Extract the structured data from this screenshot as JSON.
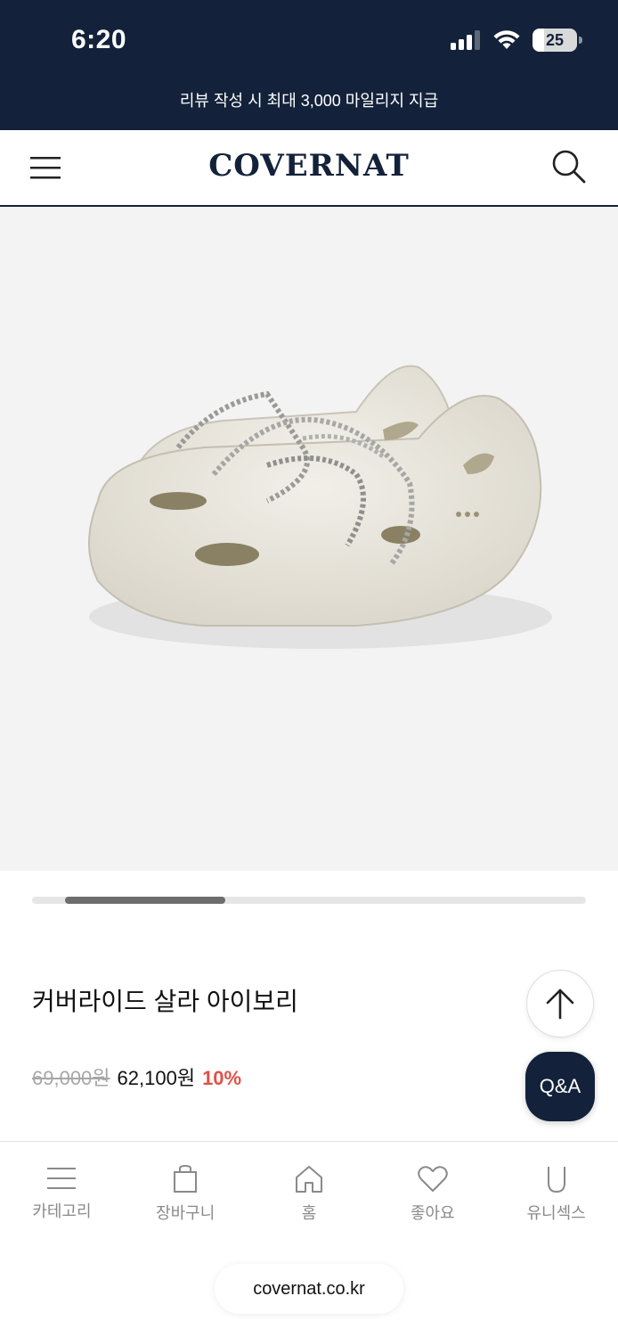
{
  "status_bar": {
    "time": "6:20",
    "battery": "25",
    "battery_level": 0.25
  },
  "promo": {
    "text": "리뷰 작성 시 최대 3,000 마일리지 지급"
  },
  "header": {
    "logo": "COVERNAT",
    "menu_icon": "hamburger-icon",
    "search_icon": "search-icon"
  },
  "gallery": {
    "scroll_position": 0.06,
    "visible_fraction": 0.29
  },
  "product": {
    "name": "커버라이드 살라 아이보리",
    "original_price": "69,000원",
    "sale_price": "62,100원",
    "discount": "10%"
  },
  "floating": {
    "qa_label": "Q&A",
    "top_icon": "arrow-up-icon"
  },
  "bottom_nav": {
    "items": [
      {
        "label": "카테고리",
        "icon": "menu-lines-icon"
      },
      {
        "label": "장바구니",
        "icon": "shopping-bag-icon"
      },
      {
        "label": "홈",
        "icon": "home-icon"
      },
      {
        "label": "좋아요",
        "icon": "heart-icon"
      },
      {
        "label": "유니섹스",
        "icon": "u-letter-icon"
      }
    ]
  },
  "browser": {
    "url": "covernat.co.kr"
  },
  "colors": {
    "navy": "#13223a",
    "discount_red": "#e0514a",
    "muted_gray": "#a7a7a7"
  }
}
